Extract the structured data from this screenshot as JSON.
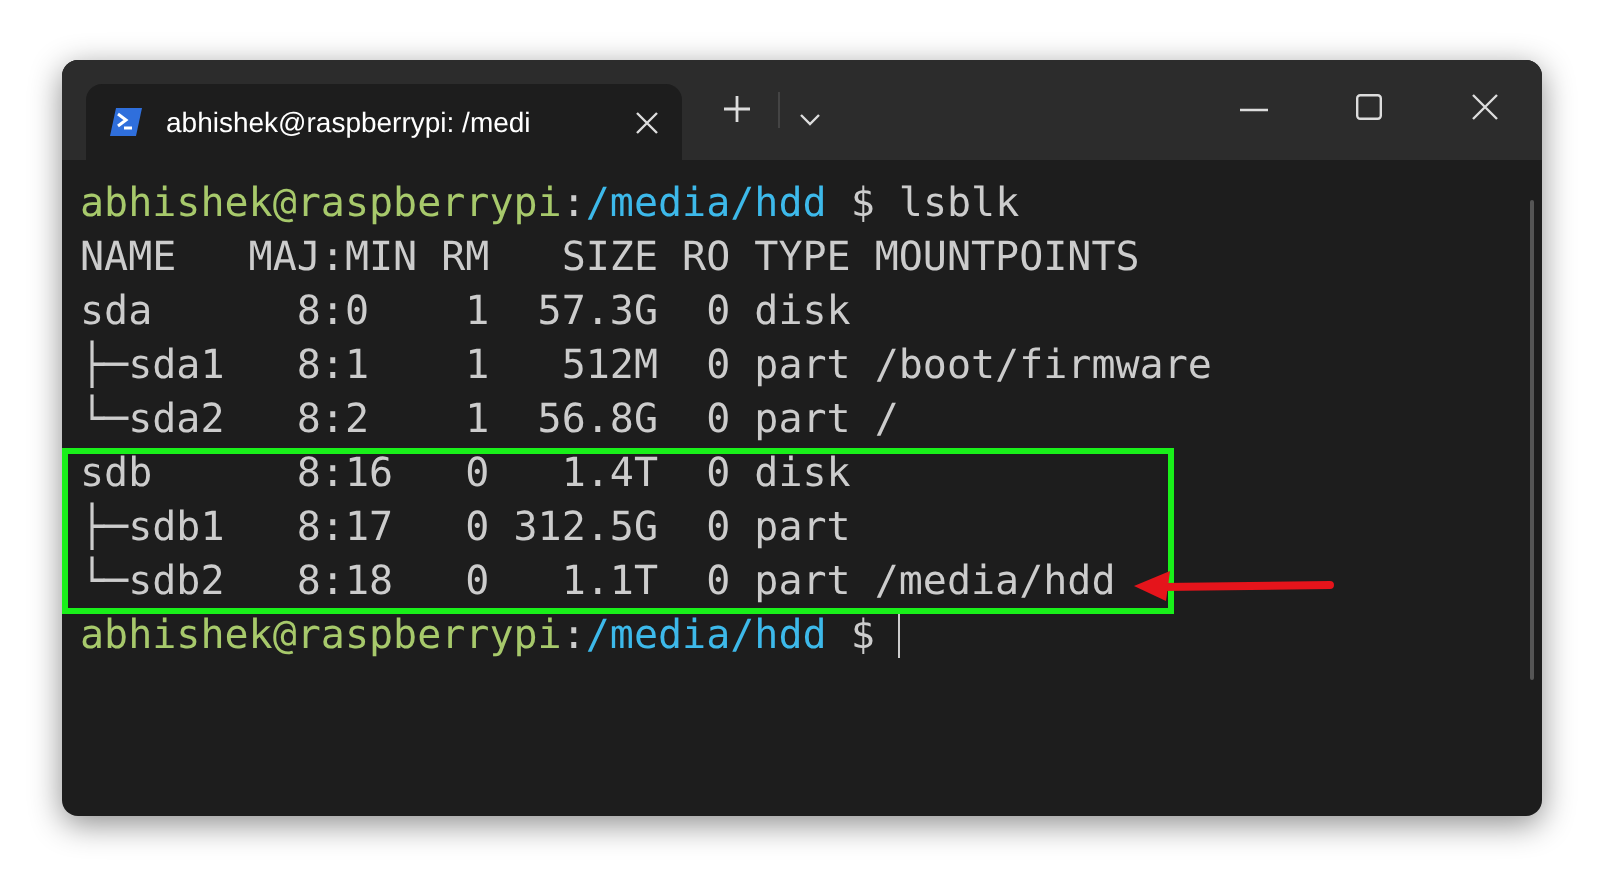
{
  "window": {
    "tab": {
      "title": "abhishek@raspberrypi: /medi",
      "selected": true
    }
  },
  "terminal": {
    "lines": [
      {
        "kind": "prompt",
        "user_host": "abhishek@raspberrypi",
        "separator": ":",
        "path": "/media/hdd",
        "symbol": "$",
        "command": "lsblk",
        "cursor": false
      },
      {
        "kind": "output",
        "text": "NAME   MAJ:MIN RM   SIZE RO TYPE MOUNTPOINTS"
      },
      {
        "kind": "output",
        "text": "sda      8:0    1  57.3G  0 disk"
      },
      {
        "kind": "output",
        "text": "├─sda1   8:1    1   512M  0 part /boot/firmware"
      },
      {
        "kind": "output",
        "text": "└─sda2   8:2    1  56.8G  0 part /"
      },
      {
        "kind": "output",
        "text": "sdb      8:16   0   1.4T  0 disk"
      },
      {
        "kind": "output",
        "text": "├─sdb1   8:17   0 312.5G  0 part"
      },
      {
        "kind": "output",
        "text": "└─sdb2   8:18   0   1.1T  0 part /media/hdd"
      },
      {
        "kind": "prompt",
        "user_host": "abhishek@raspberrypi",
        "separator": ":",
        "path": "/media/hdd",
        "symbol": "$",
        "cursor": true
      }
    ]
  }
}
